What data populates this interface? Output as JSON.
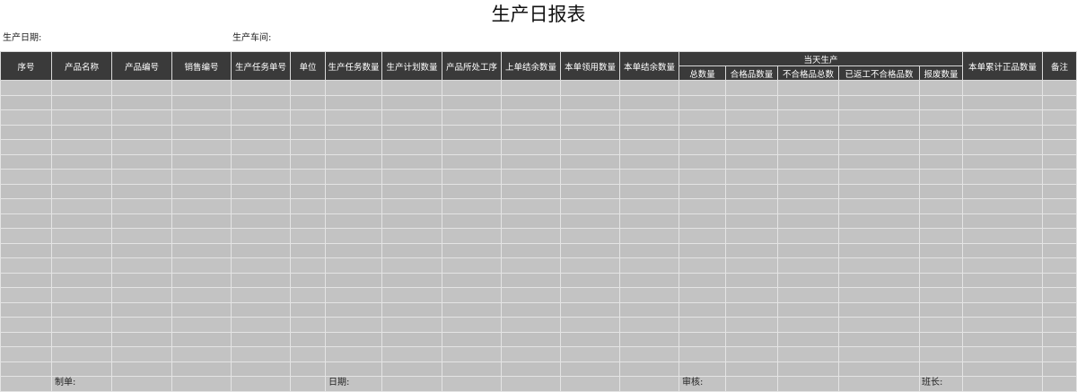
{
  "title": "生产日报表",
  "meta": {
    "date_label": "生产日期:",
    "workshop_label": "生产车间:"
  },
  "table": {
    "columns": {
      "seq": "序号",
      "product_name": "产品名称",
      "product_code": "产品编号",
      "sales_code": "销售编号",
      "task_no": "生产任务单号",
      "unit": "单位",
      "task_qty": "生产任务数量",
      "plan_qty": "生产计划数量",
      "process": "产品所处工序",
      "prev_balance": "上单结余数量",
      "received_qty": "本单领用数量",
      "balance_qty": "本单结余数量",
      "today_group": "当天生产",
      "today_total": "总数量",
      "today_pass": "合格品数量",
      "today_fail": "不合格品总数",
      "today_rework": "已返工不合格品数",
      "today_scrap": "报废数量",
      "cumulative_pass": "本单累计正品数量",
      "remark": "备注"
    },
    "row_count": 21
  },
  "footer": {
    "maker_label": "制单:",
    "date_label": "日期:",
    "review_label": "审核:",
    "leader_label": "班长:"
  }
}
